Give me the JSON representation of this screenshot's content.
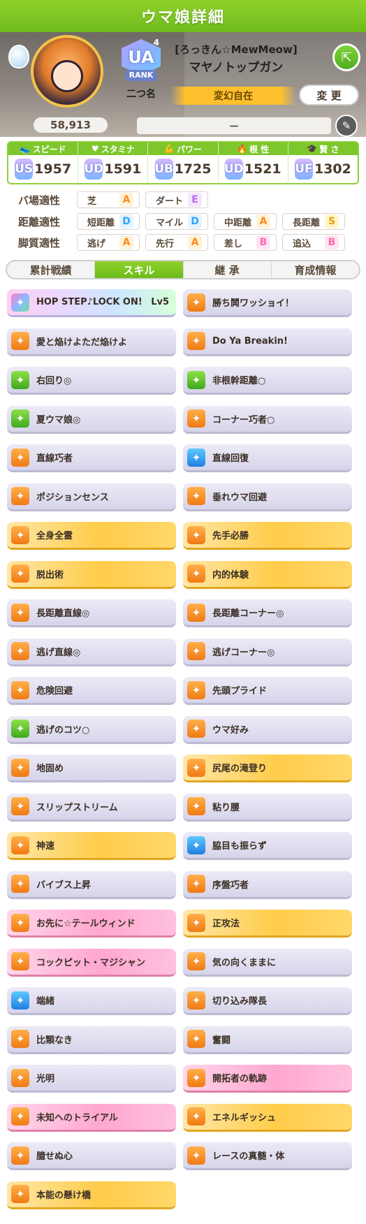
{
  "header": {
    "title": "ウマ娘詳細"
  },
  "profile": {
    "fans": "58,913",
    "rank_label": "RANK",
    "rank_grade": "UA",
    "rank_sup": "4",
    "nickname_title": "二つ名",
    "costume_title": "[ろっきん☆MewMeow]",
    "character_name": "マヤノトップガン",
    "nickname": "変幻自在",
    "change_label": "変 更",
    "comment": "－"
  },
  "stats": [
    {
      "icon": "shoe-icon",
      "label": "スピード",
      "grade": "US",
      "value": "1957"
    },
    {
      "icon": "heart-icon",
      "label": "スタミナ",
      "grade": "UD",
      "value": "1591"
    },
    {
      "icon": "muscle-icon",
      "label": "パワー",
      "grade": "UB",
      "value": "1725"
    },
    {
      "icon": "flame-icon",
      "label": "根 性",
      "grade": "UD",
      "value": "1521"
    },
    {
      "icon": "cap-icon",
      "label": "賢 さ",
      "grade": "UF",
      "value": "1302"
    }
  ],
  "aptitudes": {
    "track": {
      "label": "バ場適性",
      "items": [
        {
          "name": "芝",
          "grade": "A"
        },
        {
          "name": "ダート",
          "grade": "E"
        }
      ]
    },
    "distance": {
      "label": "距離適性",
      "items": [
        {
          "name": "短距離",
          "grade": "D"
        },
        {
          "name": "マイル",
          "grade": "D"
        },
        {
          "name": "中距離",
          "grade": "A"
        },
        {
          "name": "長距離",
          "grade": "S"
        }
      ]
    },
    "style": {
      "label": "脚質適性",
      "items": [
        {
          "name": "逃げ",
          "grade": "A"
        },
        {
          "name": "先行",
          "grade": "A"
        },
        {
          "name": "差し",
          "grade": "B"
        },
        {
          "name": "追込",
          "grade": "B"
        }
      ]
    }
  },
  "tabs": [
    "累計戦績",
    "スキル",
    "継 承",
    "育成情報"
  ],
  "skills": [
    {
      "name": "HOP STEP♪LOCK ON!",
      "level": "Lv5",
      "style": "rainbow",
      "icon": "ic-rainbow"
    },
    {
      "name": "勝ち鬨ワッショイ！",
      "level": "",
      "style": "plain",
      "icon": "ic-orange"
    },
    {
      "name": "愛と焔けよただ焔けよ",
      "level": "",
      "style": "plain",
      "icon": "ic-orange"
    },
    {
      "name": "Do Ya Breakin!",
      "level": "",
      "style": "plain",
      "icon": "ic-orange"
    },
    {
      "name": "右回り◎",
      "level": "",
      "style": "plain",
      "icon": "ic-green"
    },
    {
      "name": "非根幹距離○",
      "level": "",
      "style": "plain",
      "icon": "ic-green"
    },
    {
      "name": "夏ウマ娘◎",
      "level": "",
      "style": "plain",
      "icon": "ic-green"
    },
    {
      "name": "コーナー巧者○",
      "level": "",
      "style": "plain",
      "icon": "ic-orange"
    },
    {
      "name": "直線巧者",
      "level": "",
      "style": "plain",
      "icon": "ic-orange"
    },
    {
      "name": "直線回復",
      "level": "",
      "style": "plain",
      "icon": "ic-blue"
    },
    {
      "name": "ポジションセンス",
      "level": "",
      "style": "plain",
      "icon": "ic-orange"
    },
    {
      "name": "垂れウマ回避",
      "level": "",
      "style": "plain",
      "icon": "ic-orange"
    },
    {
      "name": "全身全霊",
      "level": "",
      "style": "gold",
      "icon": "ic-orange"
    },
    {
      "name": "先手必勝",
      "level": "",
      "style": "gold",
      "icon": "ic-orange"
    },
    {
      "name": "脱出術",
      "level": "",
      "style": "gold",
      "icon": "ic-orange"
    },
    {
      "name": "内的体験",
      "level": "",
      "style": "gold",
      "icon": "ic-orange"
    },
    {
      "name": "長距離直線◎",
      "level": "",
      "style": "plain",
      "icon": "ic-orange"
    },
    {
      "name": "長距離コーナー◎",
      "level": "",
      "style": "plain",
      "icon": "ic-orange"
    },
    {
      "name": "逃げ直線◎",
      "level": "",
      "style": "plain",
      "icon": "ic-orange"
    },
    {
      "name": "逃げコーナー◎",
      "level": "",
      "style": "plain",
      "icon": "ic-orange"
    },
    {
      "name": "危険回避",
      "level": "",
      "style": "plain",
      "icon": "ic-orange"
    },
    {
      "name": "先頭プライド",
      "level": "",
      "style": "plain",
      "icon": "ic-orange"
    },
    {
      "name": "逃げのコツ○",
      "level": "",
      "style": "plain",
      "icon": "ic-green"
    },
    {
      "name": "ウマ好み",
      "level": "",
      "style": "plain",
      "icon": "ic-orange"
    },
    {
      "name": "地固め",
      "level": "",
      "style": "plain",
      "icon": "ic-orange"
    },
    {
      "name": "尻尾の滝登り",
      "level": "",
      "style": "gold",
      "icon": "ic-orange"
    },
    {
      "name": "スリップストリーム",
      "level": "",
      "style": "plain",
      "icon": "ic-orange"
    },
    {
      "name": "粘り腰",
      "level": "",
      "style": "plain",
      "icon": "ic-orange"
    },
    {
      "name": "神速",
      "level": "",
      "style": "gold",
      "icon": "ic-orange"
    },
    {
      "name": "脇目も振らず",
      "level": "",
      "style": "plain",
      "icon": "ic-blue"
    },
    {
      "name": "バイブス上昇",
      "level": "",
      "style": "plain",
      "icon": "ic-orange"
    },
    {
      "name": "序盤巧者",
      "level": "",
      "style": "plain",
      "icon": "ic-orange"
    },
    {
      "name": "お先に☆テールウィンド",
      "level": "",
      "style": "pink",
      "icon": "ic-orange"
    },
    {
      "name": "正攻法",
      "level": "",
      "style": "gold",
      "icon": "ic-orange"
    },
    {
      "name": "コックピット・マジシャン",
      "level": "",
      "style": "pink",
      "icon": "ic-orange"
    },
    {
      "name": "気の向くままに",
      "level": "",
      "style": "plain",
      "icon": "ic-orange"
    },
    {
      "name": "端緒",
      "level": "",
      "style": "plain",
      "icon": "ic-blue"
    },
    {
      "name": "切り込み隊長",
      "level": "",
      "style": "plain",
      "icon": "ic-orange"
    },
    {
      "name": "比類なき",
      "level": "",
      "style": "plain",
      "icon": "ic-orange"
    },
    {
      "name": "奮闘",
      "level": "",
      "style": "plain",
      "icon": "ic-orange"
    },
    {
      "name": "光明",
      "level": "",
      "style": "plain",
      "icon": "ic-orange"
    },
    {
      "name": "開拓者の軌跡",
      "level": "",
      "style": "pink",
      "icon": "ic-orange"
    },
    {
      "name": "未知へのトライアル",
      "level": "",
      "style": "pink",
      "icon": "ic-orange"
    },
    {
      "name": "エネルギッシュ",
      "level": "",
      "style": "gold",
      "icon": "ic-orange"
    },
    {
      "name": "臆せぬ心",
      "level": "",
      "style": "plain",
      "icon": "ic-orange"
    },
    {
      "name": "レースの真髄・体",
      "level": "",
      "style": "plain",
      "icon": "ic-orange"
    },
    {
      "name": "本能の懸け橋",
      "level": "",
      "style": "gold",
      "icon": "ic-orange"
    }
  ]
}
